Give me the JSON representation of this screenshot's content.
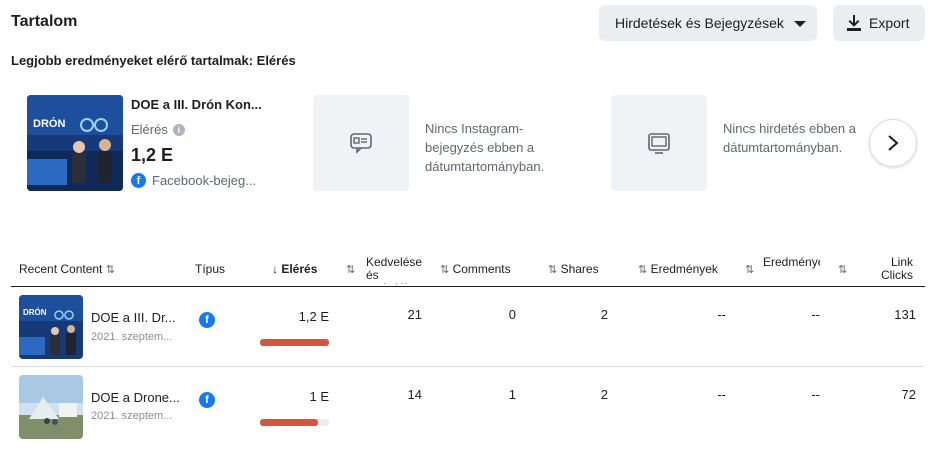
{
  "header": {
    "title": "Tartalom",
    "dropdown_label": "Hirdetések és Bejegyzések",
    "export_label": "Export"
  },
  "subtitle": "Legjobb eredményeket elérő tartalmak: Elérés",
  "cards": {
    "top": {
      "title": "DOE a III. Drón Kon...",
      "metric_label": "Elérés",
      "value": "1,2 E",
      "source": "Facebook-bejeg..."
    },
    "instagram_empty": "Nincs Instagram-bejegyzés ebben a dátumtartományban.",
    "ads_empty": "Nincs hirdetés ebben a dátumtartományban."
  },
  "table": {
    "headers": {
      "recent_content": "Recent Content",
      "type": "Típus",
      "reach": "Elérés",
      "likes": "Kedvelések és reakciók",
      "comments": "Comments",
      "shares": "Shares",
      "results": "Eredmények",
      "results2": "Eredménye",
      "link_clicks": "Link Clicks"
    },
    "rows": [
      {
        "title": "DOE a III. Dr...",
        "date": "2021. szeptem...",
        "reach": "1,2 E",
        "reach_fraction": 1.0,
        "likes": "21",
        "comments": "0",
        "shares": "2",
        "results": "--",
        "results2": "--",
        "link_clicks": "131"
      },
      {
        "title": "DOE a Drone...",
        "date": "2021. szeptem...",
        "reach": "1 E",
        "reach_fraction": 0.84,
        "likes": "14",
        "comments": "1",
        "shares": "2",
        "results": "--",
        "results2": "--",
        "link_clicks": "72"
      }
    ]
  },
  "colors": {
    "accent_bar": "#d3573f",
    "facebook": "#1877f2"
  }
}
